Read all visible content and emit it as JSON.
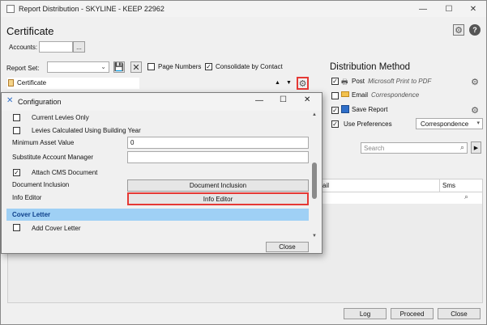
{
  "window": {
    "title": "Report Distribution - SKYLINE - KEEP 22962",
    "minimize": "—",
    "maximize": "☐",
    "close": "✕"
  },
  "header": {
    "title": "Certificate",
    "accounts_label": "Accounts:",
    "accounts_value": "",
    "browse_label": "..."
  },
  "toolbar": {
    "report_set_label": "Report Set:",
    "report_set_value": "",
    "page_numbers_label": "Page Numbers",
    "page_numbers_checked": false,
    "consolidate_label": "Consolidate by Contact",
    "consolidate_checked": true
  },
  "certificate_row": {
    "label": "Certificate",
    "up": "▲",
    "down": "▼"
  },
  "distribution": {
    "title": "Distribution Method",
    "post": {
      "label": "Post",
      "detail": "Microsoft Print to PDF",
      "checked": true
    },
    "email": {
      "label": "Email",
      "detail": "Correspondence",
      "checked": false
    },
    "save": {
      "label": "Save Report",
      "checked": true
    },
    "prefs": {
      "label": "Use Preferences",
      "checked": true,
      "select_value": "Correspondence"
    }
  },
  "search": {
    "placeholder": "Search"
  },
  "grid": {
    "col_email": "ail",
    "col_sms": "Sms"
  },
  "footer": {
    "log": "Log",
    "proceed": "Proceed",
    "close": "Close"
  },
  "config": {
    "title": "Configuration",
    "items": {
      "current_levies": {
        "label": "Current Levies Only",
        "checked": false
      },
      "levies_calc": {
        "label": "Levies Calculated Using Building Year",
        "checked": false
      },
      "min_asset_label": "Minimum Asset Value",
      "min_asset_value": "0",
      "sub_manager_label": "Substitute Account Manager",
      "sub_manager_value": "",
      "attach_cms": {
        "label": "Attach CMS Document",
        "checked": true
      },
      "doc_inclusion_label": "Document Inclusion",
      "doc_inclusion_button": "Document Inclusion",
      "info_editor_label": "Info Editor",
      "info_editor_button": "Info Editor",
      "cover_letter_header": "Cover Letter",
      "add_cover": {
        "label": "Add Cover Letter",
        "checked": false
      }
    },
    "close_button": "Close"
  },
  "colors": {
    "highlight_red": "#e53935",
    "section_blue": "#9fd0f5",
    "accent_blue": "#1a73e8"
  }
}
